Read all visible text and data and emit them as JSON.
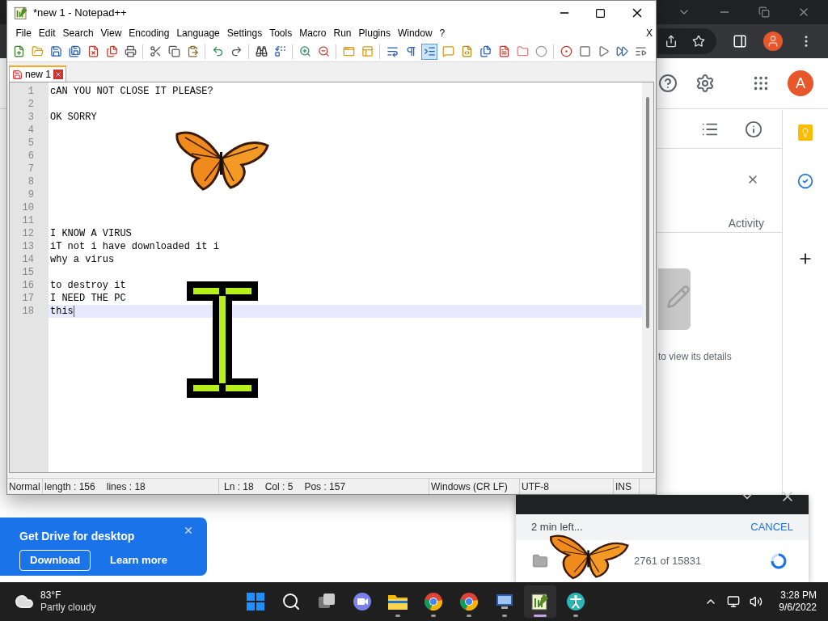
{
  "browser": {
    "avatar": "A",
    "activity_label": "Activity",
    "details_hint": "to view its details"
  },
  "notepad": {
    "title": "*new 1 - Notepad++",
    "menu": [
      "File",
      "Edit",
      "Search",
      "View",
      "Encoding",
      "Language",
      "Settings",
      "Tools",
      "Macro",
      "Run",
      "Plugins",
      "Window",
      "?"
    ],
    "menu_close": "X",
    "tabs": [
      {
        "label": "new 1",
        "selected": true
      }
    ],
    "lines": [
      {
        "number": "1",
        "text": "cAN YOU NOT CLOSE IT PLEASE?",
        "current": false
      },
      {
        "number": "2",
        "current": false
      },
      {
        "number": "3",
        "text": "OK SORRY",
        "current": false
      },
      {
        "number": "4",
        "current": false
      },
      {
        "number": "5",
        "current": false
      },
      {
        "number": "6",
        "current": false
      },
      {
        "number": "7",
        "current": false
      },
      {
        "number": "8",
        "current": false
      },
      {
        "number": "9",
        "current": false
      },
      {
        "number": "10",
        "current": false
      },
      {
        "number": "11",
        "current": false
      },
      {
        "number": "12",
        "text": "I KNOW A VIRUS",
        "current": false
      },
      {
        "number": "13",
        "text": "iT not i have downloaded it i",
        "current": false
      },
      {
        "number": "14",
        "text": "why a virus",
        "current": false
      },
      {
        "number": "15",
        "current": false
      },
      {
        "number": "16",
        "text": "to destroy it",
        "current": false
      },
      {
        "number": "17",
        "text": "I NEED THE PC",
        "current": false
      },
      {
        "number": "18",
        "text": "this",
        "current": true
      }
    ],
    "status_bar": [
      [
        "Normal"
      ],
      [
        "length : 156",
        "lines : 18"
      ],
      [
        "Ln : 18",
        "Col : 5",
        "Pos : 157"
      ],
      [
        "Windows (CR LF)"
      ],
      [
        "UTF-8"
      ],
      [
        "INS"
      ]
    ]
  },
  "promo": {
    "title": "Get Drive for desktop",
    "buttons": [
      "Download",
      "Learn more"
    ]
  },
  "upload": {
    "time_left": "2 min left...",
    "cancel": "CANCEL",
    "progress": "2761 of 15831"
  },
  "taskbar": {
    "temperature": "83°F",
    "weather": "Partly cloudy",
    "time": "3:28 PM",
    "date": "9/6/2022",
    "apps": [
      {
        "kind": "start",
        "running": false,
        "active": false
      },
      {
        "kind": "search",
        "running": false,
        "active": false
      },
      {
        "kind": "taskview",
        "running": false,
        "active": false
      },
      {
        "kind": "chat",
        "running": false,
        "active": false
      },
      {
        "kind": "explorer",
        "running": true,
        "active": false
      },
      {
        "kind": "chrome",
        "running": true,
        "active": false
      },
      {
        "kind": "chrome",
        "running": true,
        "active": false
      },
      {
        "kind": "monitor",
        "running": true,
        "active": false
      },
      {
        "kind": "notepad",
        "running": true,
        "active": true
      },
      {
        "kind": "accessibility",
        "running": true,
        "active": false
      }
    ]
  }
}
